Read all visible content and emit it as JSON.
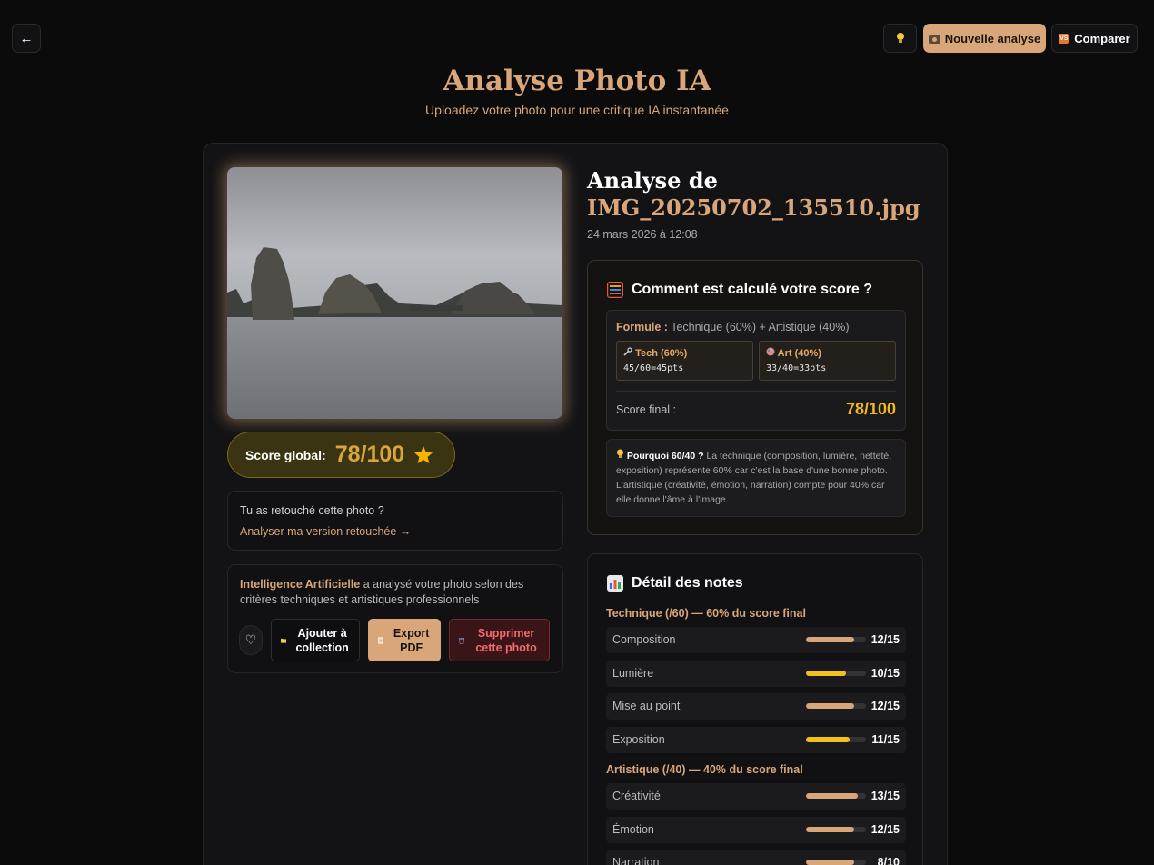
{
  "toolbar": {
    "back_label": "←",
    "bulb_icon": "lightbulb-icon",
    "new_analysis_label": "Nouvelle analyse",
    "compare_label": "Comparer"
  },
  "header": {
    "title": "Analyse Photo IA",
    "subtitle": "Uploadez votre photo pour une critique IA instantanée"
  },
  "photo": {
    "score_label": "Score global:",
    "score_value": "78/100"
  },
  "retouch": {
    "question": "Tu as retouché cette photo ?",
    "link": "Analyser ma version retouchée →"
  },
  "ai_box": {
    "highlight": "Intelligence Artificielle",
    "text": " a analysé votre photo selon des critères techniques et artistiques professionnels",
    "add_label": "Ajouter à collection",
    "pdf_label": "Export PDF",
    "delete_label": "Supprimer cette photo"
  },
  "analysis": {
    "heading": "Analyse de",
    "filename": "IMG_20250702_135510.jpg",
    "date": "24 mars 2026 à 12:08"
  },
  "calc": {
    "title": "Comment est calculé votre score ?",
    "formula_label": "Formule :",
    "formula": " Technique (60%) + Artistique (40%)",
    "tech_label": "Tech (60%)",
    "tech_value": "45/60=45pts",
    "art_label": "Art (40%)",
    "art_value": "33/40=33pts",
    "final_label": "Score final :",
    "final_value": "78/100",
    "why_label": "Pourquoi 60/40 ?",
    "why_text": " La technique (composition, lumière, netteté, exposition) représente 60% car c'est la base d'une bonne photo. L'artistique (créativité, émotion, narration) compte pour 40% car elle donne l'âme à l'image."
  },
  "details": {
    "title": "Détail des notes",
    "tech_section": "Technique (/60) — 60% du score final",
    "art_section": "Artistique (/40) — 40% du score final",
    "tech_rows": [
      {
        "name": "Composition",
        "score": "12/15",
        "fraction": 0.8,
        "color": "#d9a679"
      },
      {
        "name": "Lumière",
        "score": "10/15",
        "fraction": 0.667,
        "color": "#f2c21d"
      },
      {
        "name": "Mise au point",
        "score": "12/15",
        "fraction": 0.8,
        "color": "#d9a679"
      },
      {
        "name": "Exposition",
        "score": "11/15",
        "fraction": 0.733,
        "color": "#f2c21d"
      }
    ],
    "art_rows": [
      {
        "name": "Créativité",
        "score": "13/15",
        "fraction": 0.867,
        "color": "#d9a679"
      },
      {
        "name": "Émotion",
        "score": "12/15",
        "fraction": 0.8,
        "color": "#d9a679"
      },
      {
        "name": "Narration",
        "score": "8/10",
        "fraction": 0.8,
        "color": "#d9a679"
      }
    ]
  },
  "colors": {
    "accent": "#d9a679",
    "score_gold": "#f2b91d",
    "danger": "#f06a6a"
  }
}
